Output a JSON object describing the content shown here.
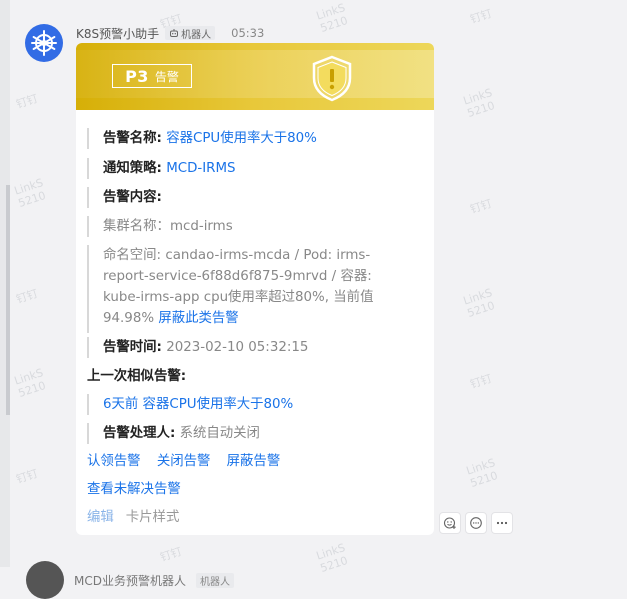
{
  "header": {
    "sender": "K8S预警小助手",
    "bot_badge": "机器人",
    "time": "05:33"
  },
  "card": {
    "level_code": "P3",
    "level_text": "告警",
    "fields": [
      {
        "label": "告警名称:",
        "value": "容器CPU使用率大于80%"
      },
      {
        "label": "通知策略:",
        "value": "MCD-IRMS"
      },
      {
        "label": "告警内容:",
        "value": ""
      }
    ],
    "cluster_line": "集群名称：mcd-irms",
    "content_lines": [
      "命名空间: candao-irms-mcda / Pod: irms-",
      "report-service-6f88d6f875-9mrvd / 容器:",
      "kube-irms-app cpu使用率超过80%, 当前值",
      "94.98%"
    ],
    "shield_link": "屏蔽此类告警",
    "alert_time_label": "告警时间:",
    "alert_time_value": "2023-02-10 05:32:15",
    "previous_label": "上一次相似告警:",
    "previous_link": "6天前 容器CPU使用率大于80%",
    "handler_label": "告警处理人:",
    "handler_value": "系统自动关闭",
    "actions": [
      "认领告警",
      "关闭告警",
      "屏蔽告警"
    ],
    "view_unresolved": "查看未解决告警",
    "edit_card_1": "编辑",
    "edit_card_2": "卡片样式"
  },
  "watermark_text": "钉钉",
  "watermark_id_1": "LinkS",
  "watermark_id_2": "5210",
  "next_message": {
    "sender": "MCD业务预警机器人",
    "bot_badge": "机器人"
  },
  "colors": {
    "link": "#1a73e8",
    "banner": "#e2c12e",
    "avatar": "#326ce5"
  }
}
